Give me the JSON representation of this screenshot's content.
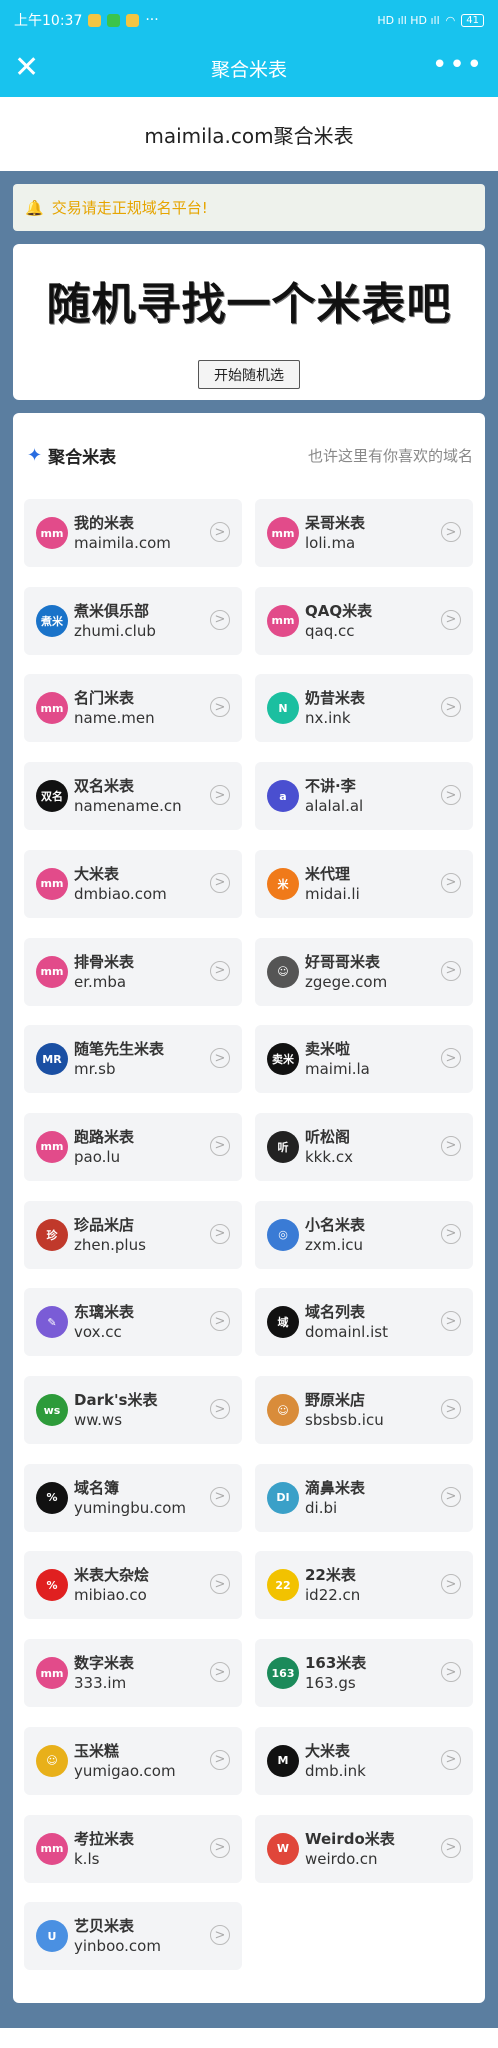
{
  "status": {
    "time": "上午10:37",
    "dots": "···",
    "signal": "HD ıll HD ıll",
    "battery": "41"
  },
  "titlebar": {
    "title": "聚合米表",
    "close": "✕",
    "more": "•••"
  },
  "header": {
    "title": "maimila.com聚合米表"
  },
  "notice": {
    "text": "交易请走正规域名平台!"
  },
  "random": {
    "title": "随机寻找一个米表吧",
    "button": "开始随机选"
  },
  "list": {
    "title": "聚合米表",
    "hint": "也许这里有你喜欢的域名",
    "items": [
      {
        "name": "我的米表",
        "domain": "maimila.com",
        "logo": "mm",
        "color": "#e24b8a"
      },
      {
        "name": "呆哥米表",
        "domain": "loli.ma",
        "logo": "mm",
        "color": "#e24b8a"
      },
      {
        "name": "煮米俱乐部",
        "domain": "zhumi.club",
        "logo": "煮米",
        "color": "#1a73c9"
      },
      {
        "name": "QAQ米表",
        "domain": "qaq.cc",
        "logo": "mm",
        "color": "#e24b8a"
      },
      {
        "name": "名门米表",
        "domain": "name.men",
        "logo": "mm",
        "color": "#e24b8a"
      },
      {
        "name": "奶昔米表",
        "domain": "nx.ink",
        "logo": "N",
        "color": "#1bbfa0"
      },
      {
        "name": "双名米表",
        "domain": "namename.cn",
        "logo": "双名",
        "color": "#111111"
      },
      {
        "name": "不讲·李",
        "domain": "alalal.al",
        "logo": "a",
        "color": "#4a4fd0"
      },
      {
        "name": "大米表",
        "domain": "dmbiao.com",
        "logo": "mm",
        "color": "#e24b8a"
      },
      {
        "name": "米代理",
        "domain": "midai.li",
        "logo": "米",
        "color": "#f07a1a"
      },
      {
        "name": "排骨米表",
        "domain": "er.mba",
        "logo": "mm",
        "color": "#e24b8a"
      },
      {
        "name": "好哥哥米表",
        "domain": "zgege.com",
        "logo": "☺",
        "color": "#555555"
      },
      {
        "name": "随笔先生米表",
        "domain": "mr.sb",
        "logo": "MR",
        "color": "#1a4fa3"
      },
      {
        "name": "卖米啦",
        "domain": "maimi.la",
        "logo": "卖米",
        "color": "#111111"
      },
      {
        "name": "跑路米表",
        "domain": "pao.lu",
        "logo": "mm",
        "color": "#e24b8a"
      },
      {
        "name": "听松阁",
        "domain": "kkk.cx",
        "logo": "听",
        "color": "#222222"
      },
      {
        "name": "珍品米店",
        "domain": "zhen.plus",
        "logo": "珍",
        "color": "#c0392b"
      },
      {
        "name": "小名米表",
        "domain": "zxm.icu",
        "logo": "◎",
        "color": "#3a7bd5"
      },
      {
        "name": "东璃米表",
        "domain": "vox.cc",
        "logo": "✎",
        "color": "#7a5cd6"
      },
      {
        "name": "域名列表",
        "domain": "domainl.ist",
        "logo": "域",
        "color": "#111111"
      },
      {
        "name": "Dark's米表",
        "domain": "ww.ws",
        "logo": "ws",
        "color": "#2d9b3a"
      },
      {
        "name": "野原米店",
        "domain": "sbsbsb.icu",
        "logo": "☺",
        "color": "#d98c3a"
      },
      {
        "name": "域名簿",
        "domain": "yumingbu.com",
        "logo": "%",
        "color": "#111111"
      },
      {
        "name": "滴鼻米表",
        "domain": "di.bi",
        "logo": "DI",
        "color": "#3aa0c8"
      },
      {
        "name": "米表大杂烩",
        "domain": "mibiao.co",
        "logo": "%",
        "color": "#e02020"
      },
      {
        "name": "22米表",
        "domain": "id22.cn",
        "logo": "22",
        "color": "#f2c200"
      },
      {
        "name": "数字米表",
        "domain": "333.im",
        "logo": "mm",
        "color": "#e24b8a"
      },
      {
        "name": "163米表",
        "domain": "163.gs",
        "logo": "163",
        "color": "#1b8a5a"
      },
      {
        "name": "玉米糕",
        "domain": "yumigao.com",
        "logo": "☺",
        "color": "#e8b01a"
      },
      {
        "name": "大米表",
        "domain": "dmb.ink",
        "logo": "M",
        "color": "#111111"
      },
      {
        "name": "考拉米表",
        "domain": "k.ls",
        "logo": "mm",
        "color": "#e24b8a"
      },
      {
        "name": "Weirdo米表",
        "domain": "weirdo.cn",
        "logo": "W",
        "color": "#e0463a"
      },
      {
        "name": "艺贝米表",
        "domain": "yinboo.com",
        "logo": "U",
        "color": "#4a90e2"
      }
    ]
  }
}
